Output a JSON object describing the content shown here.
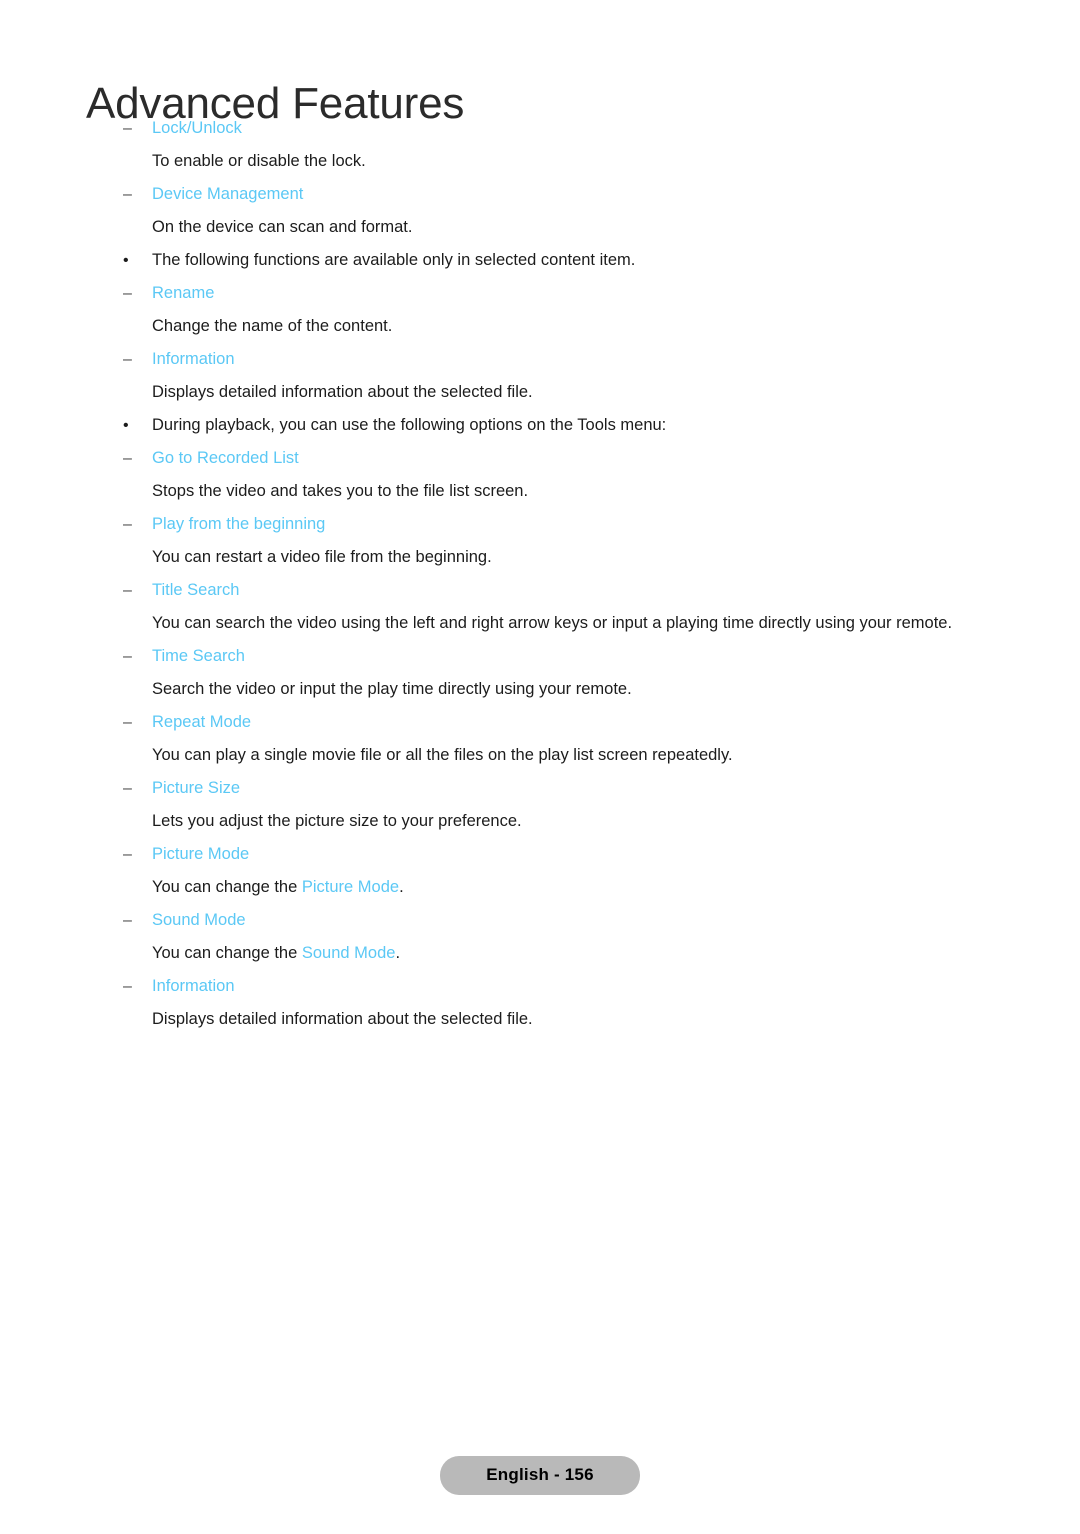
{
  "document": {
    "title": "Advanced Features",
    "language_page_label": "English - 156"
  },
  "theme": {
    "accent_cyan": "#5bc8f5",
    "body_text": "#1c1c1c",
    "title_text": "#2b2b2b",
    "footer_pill_bg": "#b9b9b9",
    "page_bg": "#ffffff"
  },
  "markers": {
    "dash": "–",
    "bullet": "•"
  },
  "blocks": [
    {
      "kind": "sub-heading",
      "marker": "–",
      "text": "Lock/Unlock"
    },
    {
      "kind": "desc",
      "text": "To enable or disable the lock."
    },
    {
      "kind": "sub-heading",
      "marker": "–",
      "text": "Device Management"
    },
    {
      "kind": "desc",
      "text": "On the device can scan and format."
    },
    {
      "kind": "bullet",
      "marker": "•",
      "text": "The following functions are available only in selected content item."
    },
    {
      "kind": "sub-heading",
      "marker": "–",
      "text": "Rename"
    },
    {
      "kind": "desc",
      "text": "Change the name of the content."
    },
    {
      "kind": "sub-heading",
      "marker": "–",
      "text": "Information"
    },
    {
      "kind": "desc",
      "text": "Displays detailed information about the selected file."
    },
    {
      "kind": "bullet",
      "marker": "•",
      "text": "During playback, you can use the following options on the Tools menu:"
    },
    {
      "kind": "sub-heading",
      "marker": "–",
      "text": "Go to Recorded List"
    },
    {
      "kind": "desc",
      "text": "Stops the video and takes you to the file list screen."
    },
    {
      "kind": "sub-heading",
      "marker": "–",
      "text": "Play from the beginning"
    },
    {
      "kind": "desc",
      "text": "You can restart a video file from the beginning."
    },
    {
      "kind": "sub-heading",
      "marker": "–",
      "text": "Title Search"
    },
    {
      "kind": "desc",
      "text": "You can search the video using the left and right arrow keys or input a playing time directly using your remote."
    },
    {
      "kind": "sub-heading",
      "marker": "–",
      "text": "Time Search"
    },
    {
      "kind": "desc",
      "text": "Search the video or input the play time directly using your remote."
    },
    {
      "kind": "sub-heading",
      "marker": "–",
      "text": "Repeat Mode"
    },
    {
      "kind": "desc",
      "text": "You can play a single movie file or all the files on the play list screen repeatedly."
    },
    {
      "kind": "sub-heading",
      "marker": "–",
      "text": "Picture Size"
    },
    {
      "kind": "desc",
      "text": "Lets you adjust the picture size to your preference."
    },
    {
      "kind": "sub-heading",
      "marker": "–",
      "text": "Picture Mode"
    },
    {
      "kind": "desc-rich",
      "parts": [
        {
          "text": "You can change the ",
          "accent": false
        },
        {
          "text": "Picture Mode",
          "accent": true
        },
        {
          "text": ".",
          "accent": false
        }
      ]
    },
    {
      "kind": "sub-heading",
      "marker": "–",
      "text": "Sound Mode"
    },
    {
      "kind": "desc-rich",
      "parts": [
        {
          "text": "You can change the ",
          "accent": false
        },
        {
          "text": "Sound Mode",
          "accent": true
        },
        {
          "text": ".",
          "accent": false
        }
      ]
    },
    {
      "kind": "sub-heading",
      "marker": "–",
      "text": "Information"
    },
    {
      "kind": "desc",
      "text": "Displays detailed information about the selected file."
    }
  ]
}
